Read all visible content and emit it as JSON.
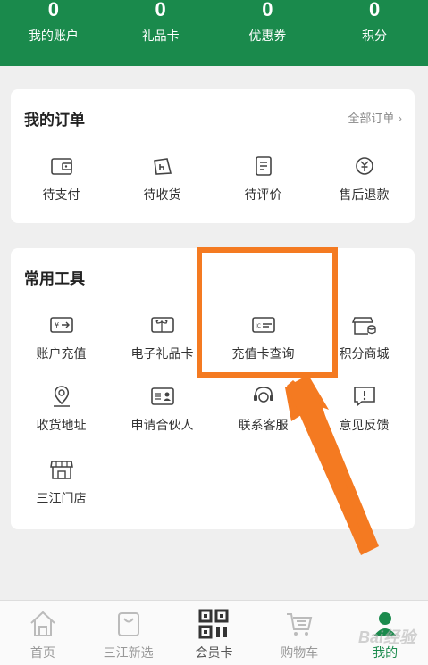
{
  "header": {
    "stats": [
      {
        "value": "0",
        "label": "我的账户"
      },
      {
        "value": "0",
        "label": "礼品卡"
      },
      {
        "value": "0",
        "label": "优惠券"
      },
      {
        "value": "0",
        "label": "积分"
      }
    ]
  },
  "orders": {
    "title": "我的订单",
    "more_label": "全部订单",
    "items": [
      {
        "label": "待支付",
        "icon": "wallet-icon"
      },
      {
        "label": "待收货",
        "icon": "delivery-icon"
      },
      {
        "label": "待评价",
        "icon": "review-icon"
      },
      {
        "label": "售后退款",
        "icon": "refund-icon"
      }
    ]
  },
  "tools": {
    "title": "常用工具",
    "items": [
      {
        "label": "账户充值",
        "icon": "recharge-icon"
      },
      {
        "label": "电子礼品卡",
        "icon": "gift-card-icon"
      },
      {
        "label": "充值卡查询",
        "icon": "card-query-icon"
      },
      {
        "label": "积分商城",
        "icon": "points-mall-icon"
      },
      {
        "label": "收货地址",
        "icon": "location-icon"
      },
      {
        "label": "申请合伙人",
        "icon": "partner-icon"
      },
      {
        "label": "联系客服",
        "icon": "headset-icon"
      },
      {
        "label": "意见反馈",
        "icon": "feedback-icon"
      },
      {
        "label": "三江门店",
        "icon": "store-icon"
      }
    ]
  },
  "bottom_nav": [
    {
      "label": "首页",
      "icon": "home-icon"
    },
    {
      "label": "三江新选",
      "icon": "shopping-bag-icon"
    },
    {
      "label": "会员卡",
      "icon": "qr-code-icon"
    },
    {
      "label": "购物车",
      "icon": "cart-icon"
    },
    {
      "label": "我的",
      "icon": "profile-icon"
    }
  ],
  "colors": {
    "brand": "#1a8a4c",
    "highlight": "#f47a21"
  },
  "watermark": "Bai经验"
}
